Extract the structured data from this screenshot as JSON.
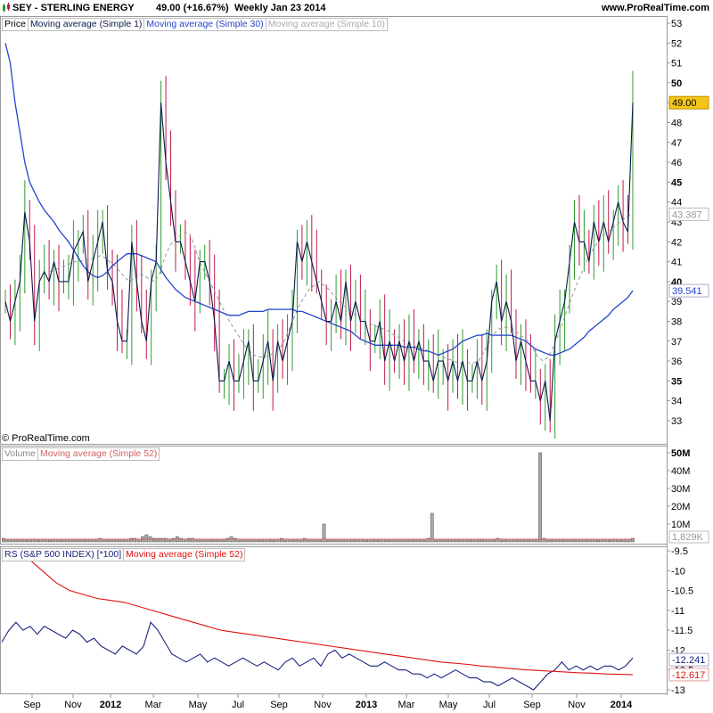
{
  "header": {
    "ticker": "SEY - STERLING ENERGY",
    "price": "49.00 (+16.67%)",
    "period": "Weekly  Jan 23 2014",
    "site": "www.ProRealTime.com"
  },
  "price_legend": {
    "price": "Price",
    "ma1": "Moving average (Simple 1)",
    "ma30": "Moving average (Simple 30)",
    "ma10": "Moving average (Simple 10)"
  },
  "volume_legend": {
    "volume": "Volume",
    "ma52": "Moving average (Simple 52)"
  },
  "rs_legend": {
    "rs": "RS (S&P 500 INDEX) [*100]",
    "ma52": "Moving average (Simple 52)"
  },
  "copyright": "© ProRealTime.com",
  "colors": {
    "up_bar": "#2e9b2e",
    "down_bar": "#c0184a",
    "close_line": "#0b1a4a",
    "ma30": "#2244cc",
    "ma10": "#999999",
    "rs_line": "#1a237e",
    "rs_ma": "#e01010",
    "price_tag": "#f5c518"
  },
  "chart_data": [
    {
      "type": "line",
      "title": "SEY - STERLING ENERGY",
      "x_ticks": [
        "Sep",
        "Nov",
        "2012",
        "Mar",
        "May",
        "Jul",
        "Sep",
        "Nov",
        "2013",
        "Mar",
        "May",
        "Jul",
        "Sep",
        "Nov",
        "2014"
      ],
      "y_ticks": [
        "53",
        "52",
        "51",
        "50",
        "49",
        "48",
        "47",
        "46",
        "45",
        "44",
        "43",
        "42",
        "41",
        "40",
        "39",
        "38",
        "37",
        "36",
        "35",
        "34",
        "33"
      ],
      "ylim": [
        33,
        53
      ],
      "last_price": "49.00",
      "ma30_last": "39.541",
      "ma10_last": "43.387",
      "series": [
        {
          "name": "Moving average (Simple 1)",
          "values": [
            39,
            38,
            39,
            40,
            43.5,
            42,
            38,
            40,
            40.5,
            40,
            41,
            40,
            40,
            40,
            41.5,
            42,
            42.5,
            40,
            41,
            42,
            43,
            40.5,
            40,
            38,
            37,
            37,
            42,
            40,
            38,
            37,
            40,
            41,
            49,
            46,
            44,
            42,
            42,
            41,
            40,
            39,
            41,
            41,
            40,
            38,
            35,
            35,
            36,
            35,
            35,
            36,
            37,
            35,
            35,
            36,
            37,
            35,
            37,
            36,
            37,
            38,
            42,
            41,
            42,
            41,
            40,
            39,
            38,
            38,
            39,
            38,
            40,
            38,
            39,
            38,
            38,
            37,
            37,
            38,
            36,
            37,
            36,
            37,
            36,
            37,
            36,
            37,
            36,
            36,
            35,
            36,
            36,
            35,
            36,
            35,
            36,
            35,
            35,
            36,
            35,
            36,
            39,
            40,
            38,
            39,
            38,
            36,
            37,
            36,
            35,
            35,
            34,
            35,
            33,
            37,
            38,
            39,
            41,
            43,
            42,
            42,
            41,
            43,
            42,
            43,
            42,
            43,
            44,
            43,
            42.5,
            49
          ]
        },
        {
          "name": "Moving average (Simple 30)",
          "values": [
            52,
            51,
            49,
            47.5,
            46,
            45,
            44.5,
            44,
            43.6,
            43.3,
            43,
            42.6,
            42.3,
            42,
            41.6,
            41.2,
            40.8,
            40.5,
            40.3,
            40.2,
            40.3,
            40.5,
            40.8,
            41,
            41.2,
            41.4,
            41.4,
            41.4,
            41.3,
            41.2,
            41.1,
            41,
            40.6,
            40.2,
            39.9,
            39.6,
            39.4,
            39.2,
            39.1,
            39,
            38.9,
            38.8,
            38.7,
            38.6,
            38.5,
            38.4,
            38.3,
            38.3,
            38.3,
            38.4,
            38.5,
            38.5,
            38.5,
            38.5,
            38.6,
            38.6,
            38.6,
            38.6,
            38.6,
            38.6,
            38.5,
            38.5,
            38.4,
            38.3,
            38.2,
            38.1,
            38,
            37.9,
            37.8,
            37.7,
            37.6,
            37.5,
            37.3,
            37.1,
            37,
            36.9,
            36.8,
            36.8,
            36.8,
            36.8,
            36.8,
            36.8,
            36.7,
            36.7,
            36.7,
            36.6,
            36.5,
            36.5,
            36.4,
            36.3,
            36.4,
            36.5,
            36.6,
            36.8,
            37,
            37.1,
            37.2,
            37.3,
            37.3,
            37.4,
            37.3,
            37.3,
            37.3,
            37.3,
            37.3,
            37.2,
            37.1,
            37,
            36.8,
            36.6,
            36.5,
            36.4,
            36.3,
            36.3,
            36.4,
            36.5,
            36.6,
            36.8,
            37,
            37.2,
            37.5,
            37.7,
            37.9,
            38.1,
            38.3,
            38.6,
            38.8,
            39,
            39.2,
            39.541
          ]
        },
        {
          "name": "Moving average (Simple 10)",
          "values": [
            null,
            null,
            null,
            null,
            null,
            null,
            null,
            null,
            null,
            40.5,
            40.6,
            40.7,
            40.8,
            40.9,
            41,
            41,
            41.1,
            41.1,
            41.2,
            41.3,
            41.2,
            41,
            40.8,
            40.5,
            40.2,
            40,
            40.2,
            40.4,
            40.3,
            40.1,
            40,
            40.4,
            41.2,
            41.8,
            42.1,
            42.3,
            42.5,
            42.4,
            41.8,
            41,
            40.5,
            40,
            39.5,
            39,
            38.5,
            38,
            37.6,
            37.2,
            36.8,
            36.5,
            36.3,
            36.2,
            36.2,
            36.3,
            36.4,
            36.6,
            37,
            37.6,
            38.2,
            38.8,
            39.2,
            39.6,
            39.8,
            40,
            39.8,
            39.6,
            39.3,
            39,
            38.8,
            38.6,
            38.4,
            38.2,
            38,
            37.9,
            37.8,
            37.7,
            37.6,
            37.5,
            37.3,
            37.2,
            37,
            36.9,
            36.8,
            36.7,
            36.6,
            36.5,
            36.4,
            36.3,
            36.2,
            36.1,
            36,
            35.9,
            35.9,
            35.9,
            35.9,
            36,
            36.4,
            36.9,
            37.3,
            37.6,
            37.7,
            37.7,
            37.6,
            37.4,
            37.2,
            37,
            36.6,
            36.2,
            36,
            36.2,
            36.7,
            37.3,
            38,
            38.7,
            39.4,
            40,
            40.6,
            41.2,
            41.6,
            42,
            42.3,
            42.5,
            42.7,
            42.9,
            43.1,
            43.3,
            43.387
          ]
        }
      ]
    },
    {
      "type": "bar",
      "title": "Volume",
      "y_ticks": [
        "50M",
        "40M",
        "30M",
        "20M",
        "10M"
      ],
      "ylim": [
        0,
        52
      ],
      "last_value": "1,829K",
      "values_m": [
        2,
        1,
        1,
        1,
        1,
        1,
        1,
        1,
        1,
        1,
        1,
        1,
        1,
        1,
        1,
        1,
        1,
        1,
        1,
        1,
        1,
        1,
        1,
        1,
        1,
        2,
        1,
        1,
        1,
        1,
        1,
        1,
        1,
        2,
        2,
        1,
        3,
        4,
        3,
        2,
        2,
        2,
        2,
        1,
        2,
        3,
        2,
        1,
        2,
        2,
        1,
        1,
        1,
        1,
        1,
        1,
        1,
        1,
        2,
        3,
        2,
        1,
        1,
        1,
        1,
        1,
        1,
        1,
        1,
        1,
        1,
        1,
        2,
        1,
        1,
        1,
        1,
        1,
        2,
        1,
        1,
        1,
        1,
        10,
        1,
        1,
        1,
        1,
        1,
        1,
        1,
        1,
        1,
        1,
        1,
        1,
        1,
        1,
        1,
        1,
        1,
        1,
        1,
        1,
        1,
        1,
        1,
        1,
        1,
        1,
        2,
        16,
        1,
        1,
        1,
        1,
        1,
        1,
        1,
        1,
        1,
        1,
        1,
        1,
        1,
        1,
        1,
        1,
        2,
        1,
        1,
        1,
        1,
        1,
        1,
        1,
        1,
        1,
        1,
        50,
        2,
        1,
        1,
        1,
        1,
        1,
        1,
        1,
        1,
        1,
        1,
        1,
        1,
        1,
        1,
        1,
        1,
        1,
        1,
        1,
        1,
        1,
        1,
        2
      ],
      "ma52_m": 1.5
    },
    {
      "type": "line",
      "title": "RS (S&P 500 INDEX) [*100]",
      "y_ticks": [
        "-9.5",
        "-10",
        "-10.5",
        "-11",
        "-11.5",
        "-12",
        "-12.5",
        "-13"
      ],
      "ylim": [
        -13,
        -9.5
      ],
      "last_rs": "-12.241",
      "last_ma": "-12.617",
      "series": [
        {
          "name": "RS (S&P 500 INDEX) [*100]",
          "values": [
            -11.8,
            -11.5,
            -11.3,
            -11.5,
            -11.4,
            -11.6,
            -11.4,
            -11.5,
            -11.6,
            -11.7,
            -11.5,
            -11.6,
            -11.8,
            -11.7,
            -11.9,
            -12,
            -12.1,
            -11.9,
            -12,
            -12.1,
            -11.9,
            -11.3,
            -11.5,
            -11.8,
            -12.1,
            -12.2,
            -12.3,
            -12.2,
            -12.1,
            -12.3,
            -12.2,
            -12.3,
            -12.4,
            -12.3,
            -12.2,
            -12.3,
            -12.4,
            -12.3,
            -12.4,
            -12.5,
            -12.3,
            -12.2,
            -12.4,
            -12.3,
            -12.2,
            -12.4,
            -12.1,
            -12,
            -12.2,
            -12.1,
            -12.2,
            -12.3,
            -12.4,
            -12.4,
            -12.3,
            -12.4,
            -12.5,
            -12.5,
            -12.6,
            -12.6,
            -12.7,
            -12.6,
            -12.7,
            -12.6,
            -12.5,
            -12.6,
            -12.7,
            -12.7,
            -12.8,
            -12.8,
            -12.9,
            -12.8,
            -12.7,
            -12.8,
            -12.9,
            -13,
            -12.8,
            -12.6,
            -12.5,
            -12.3,
            -12.5,
            -12.4,
            -12.5,
            -12.4,
            -12.5,
            -12.4,
            -12.4,
            -12.5,
            -12.4,
            -12.2
          ]
        },
        {
          "name": "Moving average (Simple 52)",
          "values": [
            -9.7,
            -10,
            -10.3,
            -10.5,
            -10.6,
            -10.7,
            -10.75,
            -10.8,
            -10.9,
            -11,
            -11.1,
            -11.2,
            -11.3,
            -11.4,
            -11.5,
            -11.55,
            -11.6,
            -11.65,
            -11.7,
            -11.75,
            -11.8,
            -11.85,
            -11.9,
            -11.95,
            -12,
            -12.05,
            -12.1,
            -12.15,
            -12.2,
            -12.25,
            -12.3,
            -12.33,
            -12.36,
            -12.4,
            -12.43,
            -12.46,
            -12.49,
            -12.51,
            -12.53,
            -12.55,
            -12.57,
            -12.58,
            -12.6,
            -12.61,
            -12.617
          ]
        }
      ]
    }
  ]
}
